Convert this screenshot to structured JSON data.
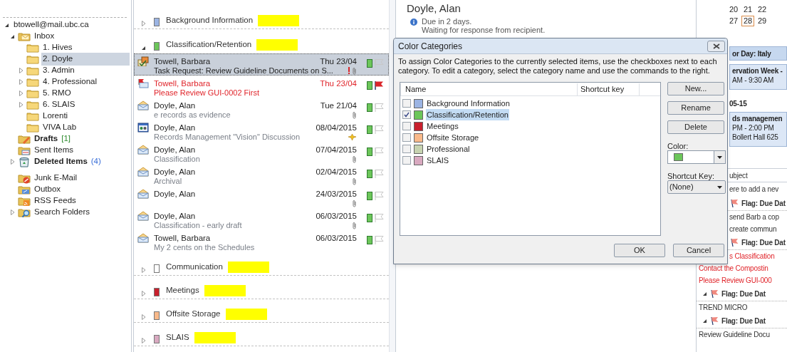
{
  "folder_pane": {
    "tree": [
      {
        "label": "btowell@mail.ubc.ca",
        "expanded": true,
        "selected": false,
        "children": [
          {
            "label": "Inbox",
            "kind": "inbox",
            "expanded": true,
            "selected": false,
            "children": [
              {
                "label": "1. Hives",
                "kind": "folder",
                "selected": false
              },
              {
                "label": "2. Doyle",
                "kind": "folder",
                "selected": true
              },
              {
                "label": "3. Admin",
                "kind": "folder",
                "expanded": false,
                "selected": false
              },
              {
                "label": "4. Professional",
                "kind": "folder",
                "expanded": false,
                "selected": false
              },
              {
                "label": "5. RMO",
                "kind": "folder",
                "expanded": false,
                "selected": false
              },
              {
                "label": "6. SLAIS",
                "kind": "folder",
                "expanded": false,
                "selected": false
              },
              {
                "label": "Lorenti",
                "kind": "folder",
                "selected": false
              },
              {
                "label": "VIVA Lab",
                "kind": "folder",
                "selected": false
              }
            ]
          },
          {
            "label": "Drafts",
            "kind": "drafts",
            "count": "[1]",
            "selected": false
          },
          {
            "label": "Sent Items",
            "kind": "sent",
            "selected": false
          },
          {
            "label": "Deleted Items",
            "kind": "deleted",
            "count": "(4)",
            "expanded": false,
            "selected": false
          },
          {
            "label": "Junk E-Mail",
            "kind": "junk",
            "selected": false
          },
          {
            "label": "Outbox",
            "kind": "outbox",
            "selected": false
          },
          {
            "label": "RSS Feeds",
            "kind": "rss",
            "selected": false
          },
          {
            "label": "Search Folders",
            "kind": "search",
            "expanded": false,
            "selected": false
          }
        ]
      }
    ]
  },
  "mail_list": {
    "groups": [
      {
        "name": "Background Information",
        "color": "#9bb4e3",
        "expanded": false,
        "highlighted": true
      },
      {
        "name": "Classification/Retention",
        "color": "#6cc65a",
        "expanded": true,
        "highlighted": true,
        "messages": [
          {
            "kind": "task_request",
            "sender": "Towell, Barbara",
            "date": "Thu 23/04",
            "subject": "Task Request: Review Guideline Documents on S...",
            "selected": true,
            "overdue": false,
            "flagged": false,
            "important": true,
            "attachment": true,
            "reminder": false
          },
          {
            "kind": "flagged_mail",
            "sender": "Towell, Barbara",
            "date": "Thu 23/04",
            "subject": "Please Review GUI-0002 First",
            "selected": false,
            "overdue": true,
            "flagged": true,
            "important": false,
            "attachment": false,
            "reminder": false
          },
          {
            "kind": "mail",
            "sender": "Doyle, Alan",
            "date": "Tue 21/04",
            "subject": "e records as evidence",
            "selected": false,
            "overdue": false,
            "flagged": false,
            "important": false,
            "attachment": true,
            "reminder": false
          },
          {
            "kind": "meeting",
            "sender": "Doyle, Alan",
            "date": "08/04/2015",
            "subject": "Records Management \"Vision\" Discussion",
            "selected": false,
            "overdue": false,
            "flagged": false,
            "important": false,
            "attachment": false,
            "reminder": true
          },
          {
            "kind": "mail",
            "sender": "Doyle, Alan",
            "date": "07/04/2015",
            "subject": "Classification",
            "selected": false,
            "overdue": false,
            "flagged": false,
            "important": false,
            "attachment": true,
            "reminder": false
          },
          {
            "kind": "mail",
            "sender": "Doyle, Alan",
            "date": "02/04/2015",
            "subject": "Archival",
            "selected": false,
            "overdue": false,
            "flagged": false,
            "important": false,
            "attachment": true,
            "reminder": false
          },
          {
            "kind": "mail",
            "sender": "Doyle, Alan",
            "date": "24/03/2015",
            "selected": false,
            "overdue": false,
            "flagged": false,
            "important": false,
            "attachment": true,
            "reminder": false
          },
          {
            "kind": "mail",
            "sender": "Doyle, Alan",
            "date": "06/03/2015",
            "subject": "Classification - early draft",
            "selected": false,
            "overdue": false,
            "flagged": false,
            "important": false,
            "attachment": true,
            "reminder": false
          },
          {
            "kind": "mail",
            "sender": "Towell, Barbara",
            "date": "06/03/2015",
            "subject": "My 2 cents on the Schedules",
            "selected": false,
            "overdue": false,
            "flagged": false,
            "important": false,
            "attachment": false,
            "reminder": false
          }
        ]
      },
      {
        "name": "Communication",
        "color": "#ffffff",
        "expanded": false,
        "highlighted": true
      },
      {
        "name": "Meetings",
        "color": "#c8202d",
        "expanded": false,
        "highlighted": true
      },
      {
        "name": "Offsite Storage",
        "color": "#f9b98a",
        "expanded": false,
        "highlighted": true
      },
      {
        "name": "SLAIS",
        "color": "#d9a9c0",
        "expanded": false,
        "highlighted": true
      }
    ]
  },
  "reading_pane": {
    "sender": "Doyle, Alan",
    "info_lines": [
      "Due in 2 days.",
      "Waiting for response from recipient."
    ]
  },
  "todo_bar": {
    "calendar_weeks": [
      [
        {
          "day": "20",
          "selected": false
        },
        {
          "day": "21",
          "selected": false
        },
        {
          "day": "22",
          "selected": false
        }
      ],
      [
        {
          "day": "27",
          "selected": false
        },
        {
          "day": "28",
          "selected": true
        },
        {
          "day": "29",
          "selected": false
        }
      ]
    ],
    "items": [
      {
        "kind": "banner",
        "text": "or Day: Italy"
      },
      {
        "kind": "appointment",
        "lines": [
          "ervation Week -",
          "AM - 9:30 AM"
        ]
      },
      {
        "kind": "date",
        "text": "05-15"
      },
      {
        "kind": "appointment",
        "lines": [
          "ds managemen",
          "PM - 2:00 PM",
          "Bollert Hall 625"
        ]
      },
      {
        "kind": "column_header",
        "text": "ubject"
      },
      {
        "kind": "new_task",
        "text": "ere to add a nev"
      },
      {
        "kind": "flag_group",
        "text": "Flag: Due Dat"
      },
      {
        "kind": "task",
        "text": "send Barb a cop",
        "overdue": false
      },
      {
        "kind": "task",
        "text": "create commun",
        "overdue": false
      },
      {
        "kind": "flag_group",
        "text": "Flag: Due Dat"
      },
      {
        "kind": "task",
        "text": "s Classification",
        "overdue": true
      },
      {
        "kind": "task",
        "text": "Contact the Compostin",
        "overdue": true
      },
      {
        "kind": "task",
        "text": "Please Review GUI-000",
        "overdue": true
      },
      {
        "kind": "flag_group",
        "text": "Flag: Due Dat",
        "expanded": true
      },
      {
        "kind": "task",
        "text": "TREND MICRO",
        "overdue": false
      },
      {
        "kind": "flag_group",
        "text": "Flag: Due Dat",
        "expanded": true
      },
      {
        "kind": "task",
        "text": "Review Guideline Docu",
        "overdue": false
      }
    ]
  },
  "dialog": {
    "title": "Color Categories",
    "instructions": "To assign Color Categories to the currently selected items, use the checkboxes next to each category.  To edit a category, select the category name and use the commands to the right.",
    "columns": [
      "Name",
      "Shortcut key"
    ],
    "categories": [
      {
        "name": "Background Information",
        "color": "#9bb4e3",
        "checked": false,
        "selected": false
      },
      {
        "name": "Classification/Retention",
        "color": "#6cc65a",
        "checked": true,
        "selected": true
      },
      {
        "name": "Meetings",
        "color": "#c8202d",
        "checked": false,
        "selected": false
      },
      {
        "name": "Offsite Storage",
        "color": "#f9b98a",
        "checked": false,
        "selected": false
      },
      {
        "name": "Professional",
        "color": "#c7d3b0",
        "checked": false,
        "selected": false
      },
      {
        "name": "SLAIS",
        "color": "#d9a9c0",
        "checked": false,
        "selected": false
      }
    ],
    "side_buttons": [
      "New...",
      "Rename",
      "Delete"
    ],
    "color_picker": {
      "label": "Color:",
      "color": "#6cc65a"
    },
    "shortcut_label": "Shortcut Key:",
    "shortcut_value": "(None)",
    "footer_buttons": [
      "OK",
      "Cancel"
    ]
  }
}
